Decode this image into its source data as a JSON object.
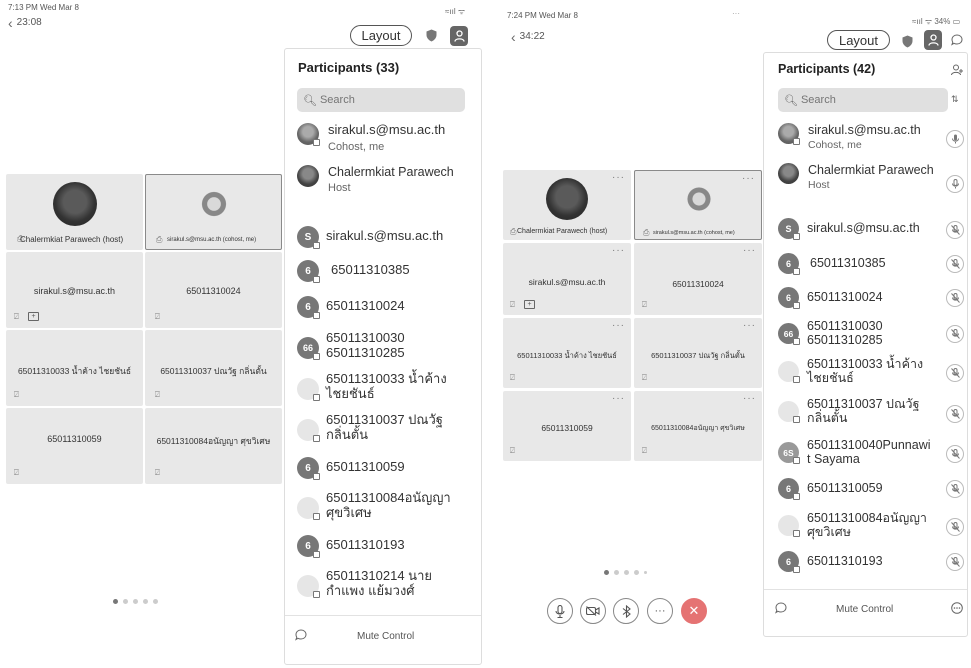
{
  "left": {
    "status_time": "7:13 PM  Wed Mar 8",
    "network": "≈ııl ᯤ",
    "timer": "23:08",
    "layout_label": "Layout",
    "tiles": [
      {
        "name": "Chalermkiat Parawech (host)",
        "selected": false
      },
      {
        "name": "sirakul.s@msu.ac.th (cohost, me)",
        "selected": true
      },
      {
        "name": "sirakul.s@msu.ac.th"
      },
      {
        "name": "65011310024"
      },
      {
        "name": "65011310033 น้ำค้าง ไชยชันธ์"
      },
      {
        "name": "65011310037 ปณวัฐ กลิ่นตั้น"
      },
      {
        "name": "65011310059"
      },
      {
        "name": "65011310084อนัญญา ศุขวิเศษ"
      }
    ],
    "panel": {
      "title": "Participants (33)",
      "search_placeholder": "Search",
      "participants": [
        {
          "name": "sirakul.s@msu.ac.th",
          "sub": "Cohost, me"
        },
        {
          "name": "Chalermkiat Parawech",
          "sub": "Host"
        },
        {
          "name": "sirakul.s@msu.ac.th",
          "initial": "S"
        },
        {
          "name": "65011310385",
          "initial": "6"
        },
        {
          "name": "65011310024",
          "initial": "6"
        },
        {
          "name": "65011310030",
          "name2": "65011310285",
          "initial": "66"
        },
        {
          "name": "65011310033 น้ำค้าง",
          "name2": "ไชยชันธ์"
        },
        {
          "name": "65011310037 ปณวัฐ",
          "name2": "กลิ่นตั้น"
        },
        {
          "name": "65011310059",
          "initial": "6"
        },
        {
          "name": "65011310084อนัญญา",
          "name2": "ศุขวิเศษ"
        },
        {
          "name": "65011310193",
          "initial": "6"
        },
        {
          "name": "65011310214 นาย",
          "name2": "กำแพง แย้มวงศ์"
        }
      ],
      "footer": "Mute Control"
    }
  },
  "right": {
    "status_time": "7:24 PM  Wed Mar 8",
    "status_dots": "···",
    "network": "≈ııl ᯤ 34% ▭",
    "timer": "34:22",
    "layout_label": "Layout",
    "tiles": [
      {
        "name": "Chalermkiat Parawech (host)"
      },
      {
        "name": "sirakul.s@msu.ac.th (cohost, me)"
      },
      {
        "name": "sirakul.s@msu.ac.th"
      },
      {
        "name": "65011310024"
      },
      {
        "name": "65011310033 น้ำค้าง ไชยชันธ์"
      },
      {
        "name": "65011310037 ปณวัฐ กลิ่นตั้น"
      },
      {
        "name": "65011310059"
      },
      {
        "name": "65011310084อนัญญา ศุขวิเศษ"
      }
    ],
    "panel": {
      "title": "Participants (42)",
      "search_placeholder": "Search",
      "participants": [
        {
          "name": "sirakul.s@msu.ac.th",
          "sub": "Cohost, me"
        },
        {
          "name": "Chalermkiat Parawech",
          "sub": "Host"
        },
        {
          "name": "sirakul.s@msu.ac.th",
          "initial": "S"
        },
        {
          "name": "65011310385",
          "initial": "6"
        },
        {
          "name": "65011310024",
          "initial": "6"
        },
        {
          "name": "65011310030",
          "name2": "65011310285",
          "initial": "66"
        },
        {
          "name": "65011310033 น้ำค้าง",
          "name2": "ไชยชันธ์"
        },
        {
          "name": "65011310037 ปณวัฐ",
          "name2": "กลิ่นตั้น"
        },
        {
          "name": "65011310040Punnawi",
          "name2": "t Sayama",
          "initial": "6S"
        },
        {
          "name": "65011310059",
          "initial": "6"
        },
        {
          "name": "65011310084อนัญญา",
          "name2": "ศุขวิเศษ"
        },
        {
          "name": "65011310193",
          "initial": "6"
        }
      ],
      "footer": "Mute Control"
    }
  },
  "icons": {
    "back": "chevron-left-icon",
    "shield": "shield-icon",
    "participants": "participants-icon",
    "chat": "chat-icon",
    "mic": "microphone-icon",
    "camera": "camera-off-icon",
    "bluetooth": "bluetooth-icon",
    "more": "more-icon",
    "end": "close-icon"
  },
  "colors": {
    "end_call": "#e57373",
    "tile_bg": "#e8e8e8",
    "panel_bg": "#ffffff"
  }
}
